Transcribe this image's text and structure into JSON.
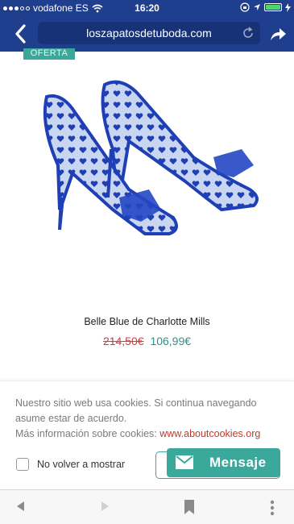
{
  "status_bar": {
    "carrier": "vodafone ES",
    "time": "16:20"
  },
  "browser": {
    "url": "loszapatosdetuboda.com"
  },
  "product": {
    "badge": "OFERTA",
    "name": "Belle Blue de Charlotte Mills",
    "old_price": "214,50€",
    "new_price": "106,99€"
  },
  "cookie_notice": {
    "line1": "Nuestro sitio web usa cookies. Si continua navegando asume estar de acuerdo.",
    "more_info": "Más información sobre cookies: ",
    "link_text": "www.aboutcookies.org",
    "checkbox_label": "No volver a mostrar",
    "chat_button": "Mensaje"
  },
  "colors": {
    "header": "#1f3e8e",
    "accent": "#3aa89b",
    "old_price": "#d9393c"
  }
}
